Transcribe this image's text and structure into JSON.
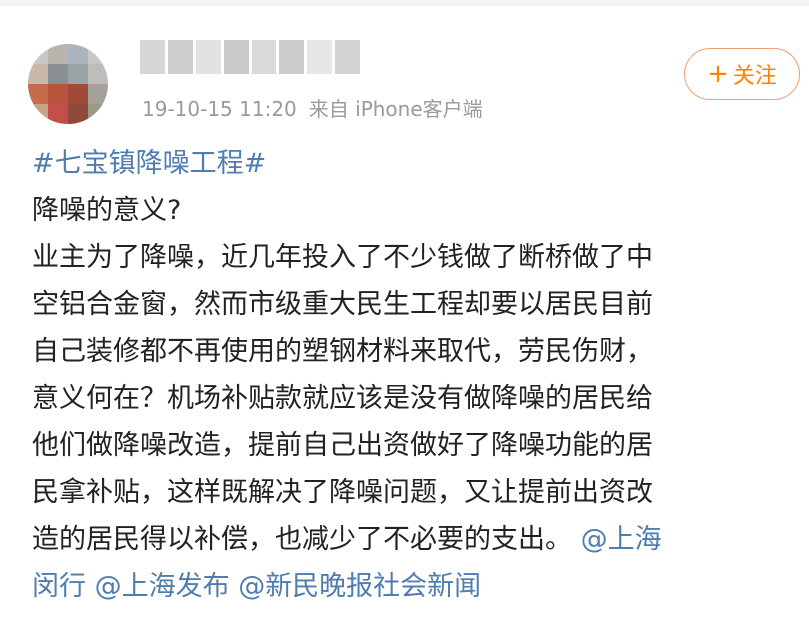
{
  "header": {
    "timestamp": "19-10-15 11:20",
    "source": "来自 iPhone客户端",
    "follow_label": "关注",
    "follow_icon": "plus-icon"
  },
  "post": {
    "hashtag": "#七宝镇降噪工程#",
    "question": "降噪的意义?",
    "lines": [
      "业主为了降噪，近几年投入了不少钱做了断桥做了中",
      "空铝合金窗，然而市级重大民生工程却要以居民目前",
      "自己装修都不再使用的塑钢材料来取代，劳民伤财，",
      "意义何在？机场补贴款就应该是没有做降噪的居民给",
      "他们做降噪改造，提前自己出资做好了降噪功能的居",
      "民拿补贴，这样既解决了降噪问题，又让提前出资改"
    ],
    "last_line_text": "造的居民得以补偿，也减少了不必要的支出。",
    "mentions": [
      "@上海闵行",
      "@上海发布",
      "@新民晚报社会新闻"
    ],
    "mention_split": [
      "@上海",
      "闵行"
    ]
  },
  "colors": {
    "link": "#507daf",
    "follow": "#ff8200",
    "meta": "#9a9a9a",
    "text": "#222222"
  }
}
